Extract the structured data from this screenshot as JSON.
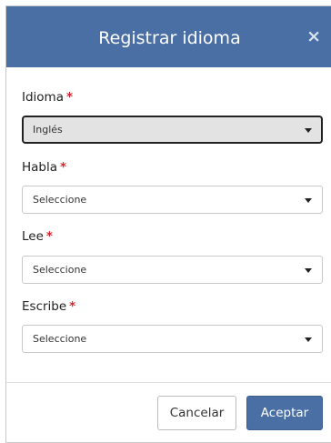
{
  "dialog": {
    "title": "Registrar idioma",
    "close_symbol": "×"
  },
  "fields": [
    {
      "label": "Idioma",
      "required_marker": "*",
      "value": "Inglés",
      "state": "focused"
    },
    {
      "label": "Habla",
      "required_marker": "*",
      "value": "Seleccione",
      "state": "default"
    },
    {
      "label": "Lee",
      "required_marker": "*",
      "value": "Seleccione",
      "state": "default"
    },
    {
      "label": "Escribe",
      "required_marker": "*",
      "value": "Seleccione",
      "state": "default"
    }
  ],
  "footer": {
    "cancel_label": "Cancelar",
    "accept_label": "Aceptar"
  },
  "colors": {
    "header_bg": "#4a6fa5",
    "primary_button": "#4a6fa5",
    "required_marker": "#d9232d",
    "focused_select_bg": "#e3e3e3"
  },
  "icons": {
    "close": "close-icon",
    "dropdown": "chevron-down-icon"
  }
}
